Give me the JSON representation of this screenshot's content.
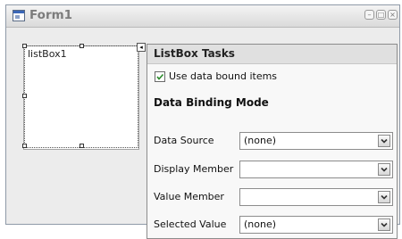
{
  "form": {
    "title": "Form1",
    "icon": "form-icon",
    "controls": [
      "minimize-icon",
      "maximize-icon",
      "close-icon"
    ]
  },
  "listbox": {
    "name": "listBox1"
  },
  "tasks": {
    "title": "ListBox Tasks",
    "use_data_bound_label": "Use data bound items",
    "use_data_bound_checked": true,
    "section_title": "Data Binding Mode",
    "rows": [
      {
        "label": "Data Source",
        "value": "(none)"
      },
      {
        "label": "Display Member",
        "value": ""
      },
      {
        "label": "Value Member",
        "value": ""
      },
      {
        "label": "Selected Value",
        "value": "(none)"
      }
    ]
  }
}
